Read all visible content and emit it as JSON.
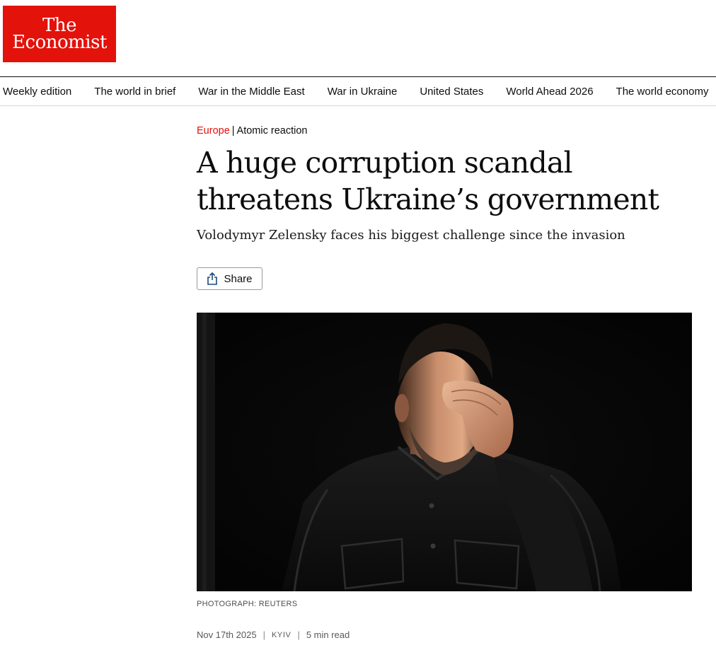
{
  "brand": {
    "logo_line1": "The",
    "logo_line2": "Economist",
    "logo_color": "#e3120b"
  },
  "nav": {
    "items": [
      {
        "label": "Weekly edition"
      },
      {
        "label": "The world in brief"
      },
      {
        "label": "War in the Middle East"
      },
      {
        "label": "War in Ukraine"
      },
      {
        "label": "United States"
      },
      {
        "label": "World Ahead 2026"
      },
      {
        "label": "The world economy"
      }
    ]
  },
  "article": {
    "section": "Europe",
    "separator": "|",
    "flytitle": "Atomic reaction",
    "headline_line1": "A huge corruption scandal",
    "headline_line2": "threatens Ukraine’s government",
    "standfirst": "Volodymyr Zelensky faces his biggest challenge since the invasion",
    "share_label": "Share",
    "share_icon": "share-icon",
    "image_credit": "PHOTOGRAPH: REUTERS",
    "date": "Nov 17th 2025",
    "dateline": "KYIV",
    "read_time": "5 min read",
    "meta_divider": "|"
  },
  "colors": {
    "accent": "#e3120b",
    "text": "#0d0d0d",
    "muted": "#595959"
  }
}
